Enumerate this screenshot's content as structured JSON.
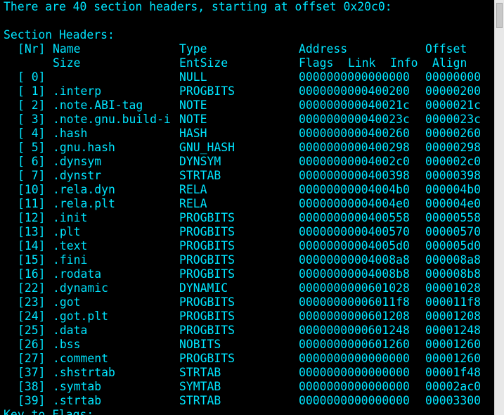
{
  "intro": "There are 40 section headers, starting at offset 0x20c0:",
  "heading": "Section Headers:",
  "header_row1": [
    "[Nr]",
    "Name",
    "Type",
    "Address",
    "Offset"
  ],
  "header_row2": [
    "Size",
    "EntSize",
    "Flags",
    "Link",
    "Info",
    "Align"
  ],
  "sections": [
    {
      "nr": "[ 0]",
      "name": "",
      "type": "NULL",
      "address": "0000000000000000",
      "offset": "00000000"
    },
    {
      "nr": "[ 1]",
      "name": ".interp",
      "type": "PROGBITS",
      "address": "0000000000400200",
      "offset": "00000200"
    },
    {
      "nr": "[ 2]",
      "name": ".note.ABI-tag",
      "type": "NOTE",
      "address": "000000000040021c",
      "offset": "0000021c"
    },
    {
      "nr": "[ 3]",
      "name": ".note.gnu.build-i",
      "type": "NOTE",
      "address": "000000000040023c",
      "offset": "0000023c"
    },
    {
      "nr": "[ 4]",
      "name": ".hash",
      "type": "HASH",
      "address": "0000000000400260",
      "offset": "00000260"
    },
    {
      "nr": "[ 5]",
      "name": ".gnu.hash",
      "type": "GNU_HASH",
      "address": "0000000000400298",
      "offset": "00000298"
    },
    {
      "nr": "[ 6]",
      "name": ".dynsym",
      "type": "DYNSYM",
      "address": "00000000004002c0",
      "offset": "000002c0"
    },
    {
      "nr": "[ 7]",
      "name": ".dynstr",
      "type": "STRTAB",
      "address": "0000000000400398",
      "offset": "00000398"
    },
    {
      "nr": "[10]",
      "name": ".rela.dyn",
      "type": "RELA",
      "address": "00000000004004b0",
      "offset": "000004b0"
    },
    {
      "nr": "[11]",
      "name": ".rela.plt",
      "type": "RELA",
      "address": "00000000004004e0",
      "offset": "000004e0"
    },
    {
      "nr": "[12]",
      "name": ".init",
      "type": "PROGBITS",
      "address": "0000000000400558",
      "offset": "00000558"
    },
    {
      "nr": "[13]",
      "name": ".plt",
      "type": "PROGBITS",
      "address": "0000000000400570",
      "offset": "00000570"
    },
    {
      "nr": "[14]",
      "name": ".text",
      "type": "PROGBITS",
      "address": "00000000004005d0",
      "offset": "000005d0"
    },
    {
      "nr": "[15]",
      "name": ".fini",
      "type": "PROGBITS",
      "address": "00000000004008a8",
      "offset": "000008a8"
    },
    {
      "nr": "[16]",
      "name": ".rodata",
      "type": "PROGBITS",
      "address": "00000000004008b8",
      "offset": "000008b8"
    },
    {
      "nr": "[22]",
      "name": ".dynamic",
      "type": "DYNAMIC",
      "address": "0000000000601028",
      "offset": "00001028"
    },
    {
      "nr": "[23]",
      "name": ".got",
      "type": "PROGBITS",
      "address": "00000000006011f8",
      "offset": "000011f8"
    },
    {
      "nr": "[24]",
      "name": ".got.plt",
      "type": "PROGBITS",
      "address": "0000000000601208",
      "offset": "00001208"
    },
    {
      "nr": "[25]",
      "name": ".data",
      "type": "PROGBITS",
      "address": "0000000000601248",
      "offset": "00001248"
    },
    {
      "nr": "[26]",
      "name": ".bss",
      "type": "NOBITS",
      "address": "0000000000601260",
      "offset": "00001260"
    },
    {
      "nr": "[27]",
      "name": ".comment",
      "type": "PROGBITS",
      "address": "0000000000000000",
      "offset": "00001260"
    },
    {
      "nr": "[37]",
      "name": ".shstrtab",
      "type": "STRTAB",
      "address": "0000000000000000",
      "offset": "00001f48"
    },
    {
      "nr": "[38]",
      "name": ".symtab",
      "type": "SYMTAB",
      "address": "0000000000000000",
      "offset": "00002ac0"
    },
    {
      "nr": "[39]",
      "name": ".strtab",
      "type": "STRTAB",
      "address": "0000000000000000",
      "offset": "00003300"
    }
  ],
  "partial_last_line": "Key to Flags:",
  "colors": {
    "background": "#000000",
    "text": "#00e5ff",
    "scrollbar": "#e8e8e8"
  }
}
